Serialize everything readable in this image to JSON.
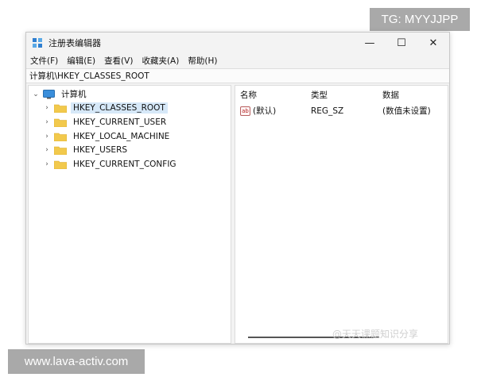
{
  "watermarks": {
    "top": "TG: MYYJJPP",
    "bottom": "www.lava-activ.com",
    "social": "@天天课题知识分享"
  },
  "window": {
    "title": "注册表编辑器",
    "controls": {
      "minimize": "—",
      "maximize": "☐",
      "close": "✕"
    }
  },
  "menu": [
    "文件(F)",
    "编辑(E)",
    "查看(V)",
    "收藏夹(A)",
    "帮助(H)"
  ],
  "address": "计算机\\HKEY_CLASSES_ROOT",
  "tree": {
    "root": "计算机",
    "items": [
      "HKEY_CLASSES_ROOT",
      "HKEY_CURRENT_USER",
      "HKEY_LOCAL_MACHINE",
      "HKEY_USERS",
      "HKEY_CURRENT_CONFIG"
    ]
  },
  "list": {
    "headers": {
      "name": "名称",
      "type": "类型",
      "data": "数据"
    },
    "rows": [
      {
        "icon": "ab",
        "name": "(默认)",
        "type": "REG_SZ",
        "data": "(数值未设置)"
      }
    ]
  },
  "colors": {
    "selection": "#d6e8f8",
    "folder": "#f2c94c",
    "icon_accent": "#2f7fd0"
  }
}
